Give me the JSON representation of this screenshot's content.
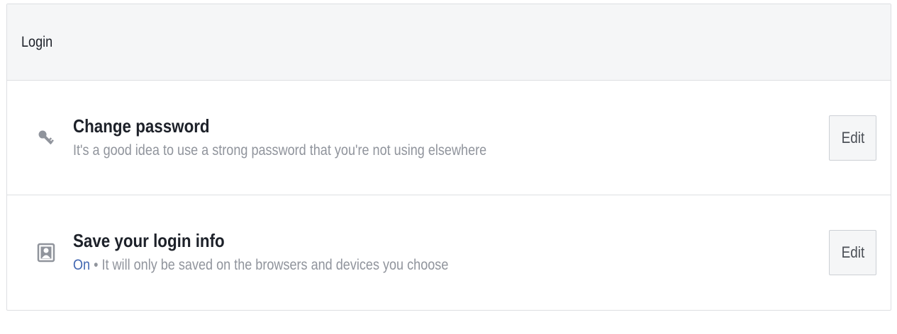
{
  "section": {
    "title": "Login"
  },
  "rows": [
    {
      "icon": "key-icon",
      "heading": "Change password",
      "description": "It's a good idea to use a strong password that you're not using elsewhere",
      "button_label": "Edit"
    },
    {
      "icon": "person-portrait-icon",
      "heading": "Save your login info",
      "status": "On",
      "separator": " • ",
      "description": "It will only be saved on the browsers and devices you choose",
      "button_label": "Edit"
    }
  ],
  "colors": {
    "header_bg": "#f5f6f7",
    "border": "#dddfe2",
    "heading_text": "#1d2129",
    "secondary_text": "#90949c",
    "status_on": "#4267b2",
    "button_bg": "#f5f6f7",
    "icon": "#90949c"
  }
}
